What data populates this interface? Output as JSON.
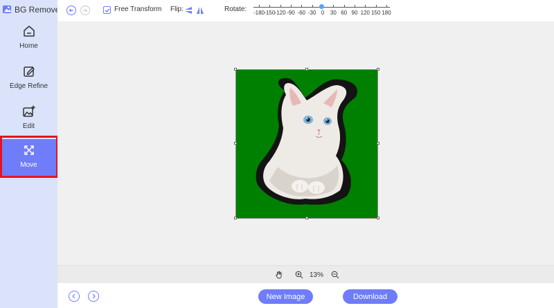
{
  "app": {
    "title": "BG Remover"
  },
  "sidebar": {
    "items": [
      {
        "label": "Home",
        "icon": "home-icon",
        "active": false
      },
      {
        "label": "Edge Refine",
        "icon": "edit-icon",
        "active": false
      },
      {
        "label": "Edit",
        "icon": "image-edit-icon",
        "active": false
      },
      {
        "label": "Move",
        "icon": "move-icon",
        "active": true
      }
    ]
  },
  "toolbar": {
    "undo_icon": "undo-icon",
    "redo_icon": "redo-icon",
    "free_transform_label": "Free Transform",
    "free_transform_checked": true,
    "flip_label": "Flip:",
    "rotate_label": "Rotate:",
    "rotate_ticks": [
      "-180",
      "-150",
      "-120",
      "-90",
      "-60",
      "-30",
      "0",
      "30",
      "60",
      "90",
      "120",
      "150",
      "180"
    ],
    "rotate_value": 0
  },
  "canvas": {
    "background_color": "#008000",
    "subject": "white kitten cutout"
  },
  "zoom": {
    "value": "13%"
  },
  "footer": {
    "new_image_label": "New Image",
    "download_label": "Download"
  },
  "colors": {
    "accent": "#6f7dfa",
    "sidebar_bg": "#dbe3fb",
    "highlight": "#e5131d"
  }
}
